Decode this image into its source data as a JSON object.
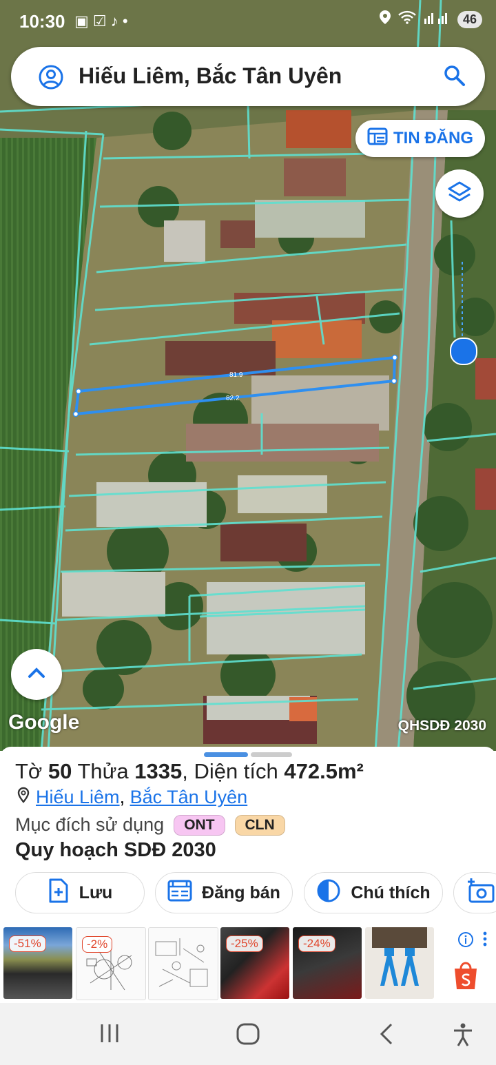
{
  "status": {
    "time": "10:30",
    "battery": "46"
  },
  "search": {
    "title": "Hiếu Liêm, Bắc Tân Uyên"
  },
  "map": {
    "tin_dang_label": "TIN ĐĂNG",
    "measure_top": "81.9",
    "measure_bottom": "82.2",
    "google_label": "Google",
    "layer_label": "QHSDĐ 2030"
  },
  "sheet": {
    "to_label": "Tờ",
    "to_value": "50",
    "thua_label": "Thửa",
    "thua_value": "1335",
    "area_label": "Diện tích",
    "area_value": "472.5m²",
    "loc_part1": "Hiếu Liêm",
    "loc_sep": ",",
    "loc_part2": "Bắc Tân Uyên",
    "purpose_label": "Mục đích sử dụng",
    "tags": [
      "ONT",
      "CLN"
    ],
    "planning": "Quy hoạch SDĐ 2030",
    "buttons": {
      "save": "Lưu",
      "sell": "Đăng bán",
      "legend": "Chú thích"
    }
  },
  "ads": {
    "discounts": [
      "-51%",
      "-2%",
      "-25%",
      "-24%"
    ]
  }
}
